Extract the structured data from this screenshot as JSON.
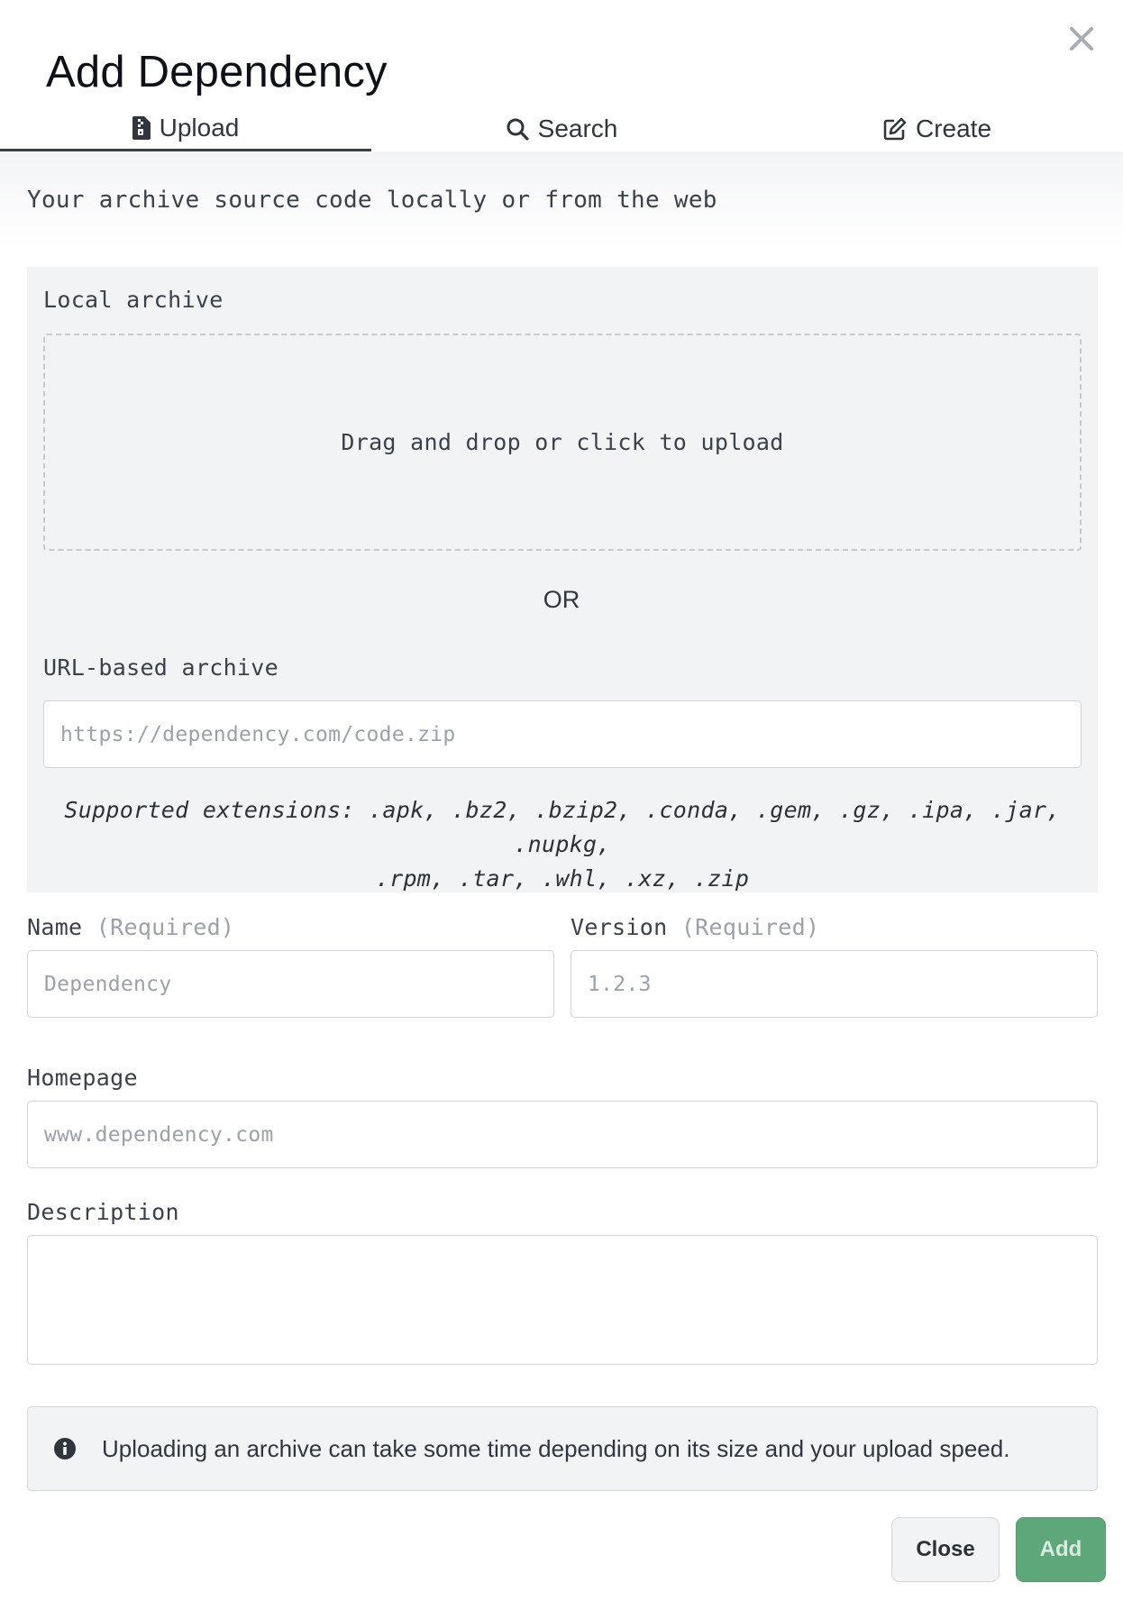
{
  "dialog": {
    "title": "Add Dependency",
    "close_icon": "close-icon"
  },
  "tabs": [
    {
      "label": "Upload",
      "icon": "file-zip-icon",
      "active": true
    },
    {
      "label": "Search",
      "icon": "search-icon",
      "active": false
    },
    {
      "label": "Create",
      "icon": "edit-icon",
      "active": false
    }
  ],
  "subtitle": "Your archive source code locally or from the web",
  "local_archive": {
    "label": "Local archive",
    "dropzone_text": "Drag and drop or click to upload"
  },
  "or_text": "OR",
  "url_archive": {
    "label": "URL-based archive",
    "placeholder": "https://dependency.com/code.zip",
    "value": "",
    "supported_line1": "Supported extensions: .apk, .bz2, .bzip2, .conda, .gem, .gz, .ipa, .jar, .nupkg,",
    "supported_line2": ".rpm, .tar, .whl, .xz, .zip"
  },
  "fields": {
    "name": {
      "label": "Name",
      "required": "(Required)",
      "placeholder": "Dependency",
      "value": ""
    },
    "version": {
      "label": "Version",
      "required": "(Required)",
      "placeholder": "1.2.3",
      "value": ""
    },
    "homepage": {
      "label": "Homepage",
      "placeholder": "www.dependency.com",
      "value": ""
    },
    "description": {
      "label": "Description",
      "value": ""
    }
  },
  "info": {
    "icon": "info-circle-icon",
    "text": "Uploading an archive can take some time depending on its size and your upload speed."
  },
  "buttons": {
    "close": "Close",
    "add": "Add"
  },
  "colors": {
    "accent_green": "#5ea77b",
    "panel_bg": "#f2f3f5",
    "tab_underline": "#3a3f44"
  }
}
